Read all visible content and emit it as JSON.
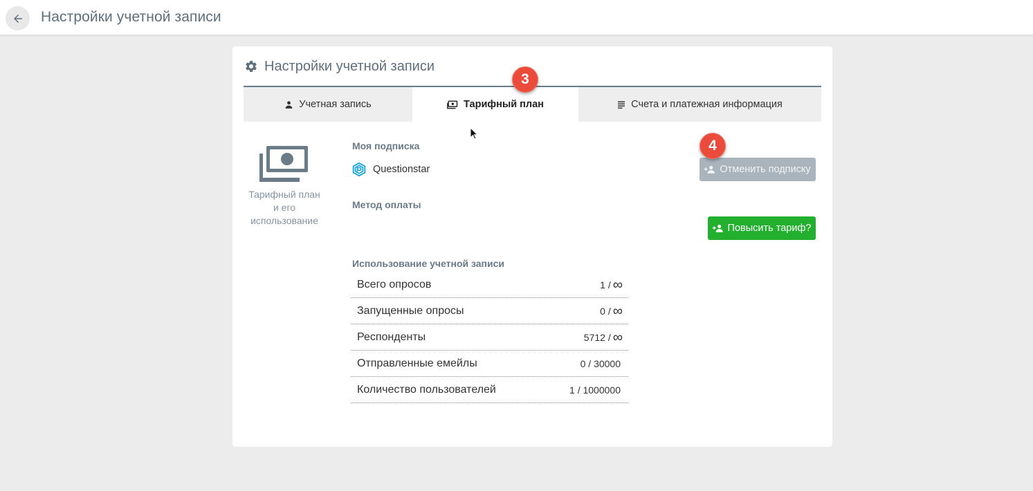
{
  "topbar": {
    "title": "Настройки учетной записи"
  },
  "card": {
    "title": "Настройки учетной записи"
  },
  "tabs": [
    {
      "label": "Учетная запись",
      "icon": "person-icon",
      "active": false
    },
    {
      "label": "Тарифный план",
      "icon": "money-icon",
      "active": true
    },
    {
      "label": "Счета и платежная информация",
      "icon": "list-icon",
      "active": false
    }
  ],
  "plan_side": {
    "label": "Тарифный план и его использование"
  },
  "subscription": {
    "heading": "Моя подписка",
    "plan_name": "Questionstar",
    "cancel_label": "Отменить подписку"
  },
  "payment": {
    "heading": "Метод оплаты",
    "upgrade_label": "Повысить тариф?"
  },
  "usage": {
    "heading": "Использование учетной записи",
    "rows": [
      {
        "name": "Всего опросов",
        "used": "1 /",
        "limit": "∞"
      },
      {
        "name": "Запущенные опросы",
        "used": "0 /",
        "limit": "∞"
      },
      {
        "name": "Респонденты",
        "used": "5712 /",
        "limit": "∞"
      },
      {
        "name": "Отправленные емейлы",
        "used": "0 / 30000",
        "limit": ""
      },
      {
        "name": "Количество пользователей",
        "used": "1 / 1000000",
        "limit": ""
      }
    ]
  },
  "markers": {
    "step3": "3",
    "step4": "4"
  },
  "colors": {
    "accent_green": "#22b02e",
    "disabled_button": "#a9b4bd",
    "marker_red": "#ea4b3b",
    "heading_slate": "#6a7a87"
  }
}
